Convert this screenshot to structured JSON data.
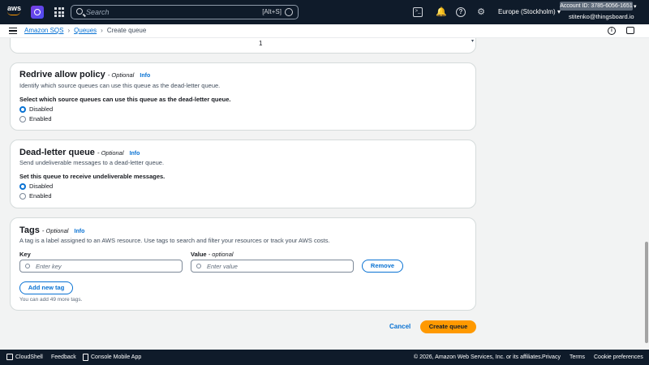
{
  "topnav": {
    "logo": "aws",
    "search_placeholder": "Search",
    "search_shortcut": "[Alt+S]",
    "region": "Europe (Stockholm)",
    "account": "Account ID: 3785-6056-1651",
    "user": "stitenko@thingsboard.io",
    "icons": [
      "service-icon",
      "apps-grid-icon",
      "search-icon",
      "cloudshell-icon",
      "bell-icon",
      "help-icon",
      "gear-icon"
    ]
  },
  "breadcrumb": {
    "items": [
      "Amazon SQS",
      "Queues",
      "Create queue"
    ]
  },
  "top_panel": {
    "value": "1"
  },
  "redrive": {
    "title": "Redrive allow policy",
    "optional": "- Optional",
    "info": "Info",
    "description": "Identify which source queues can use this queue as the dead-letter queue.",
    "label": "Select which source queues can use this queue as the dead-letter queue.",
    "options": [
      "Disabled",
      "Enabled"
    ],
    "selected": "Disabled"
  },
  "dlq": {
    "title": "Dead-letter queue",
    "optional": "- Optional",
    "info": "Info",
    "description": "Send undeliverable messages to a dead-letter queue.",
    "label": "Set this queue to receive undeliverable messages.",
    "options": [
      "Disabled",
      "Enabled"
    ],
    "selected": "Disabled"
  },
  "tags": {
    "title": "Tags",
    "optional": "- Optional",
    "info": "Info",
    "description": "A tag is a label assigned to an AWS resource. Use tags to search and filter your resources or track your AWS costs.",
    "key_label": "Key",
    "value_label": "Value",
    "value_optional": "- optional",
    "key_placeholder": "Enter key",
    "value_placeholder": "Enter value",
    "remove": "Remove",
    "add": "Add new tag",
    "note": "You can add 49 more tags."
  },
  "actions": {
    "cancel": "Cancel",
    "create": "Create queue"
  },
  "footer": {
    "cloudshell": "CloudShell",
    "feedback": "Feedback",
    "console_mobile": "Console Mobile App",
    "copyright": "© 2026, Amazon Web Services, Inc. or its affiliates.",
    "privacy": "Privacy",
    "terms": "Terms",
    "cookies": "Cookie preferences"
  },
  "colors": {
    "accent": "#0972d3",
    "primary_button": "#ff9900",
    "nav_bg": "#0f1b2a"
  }
}
